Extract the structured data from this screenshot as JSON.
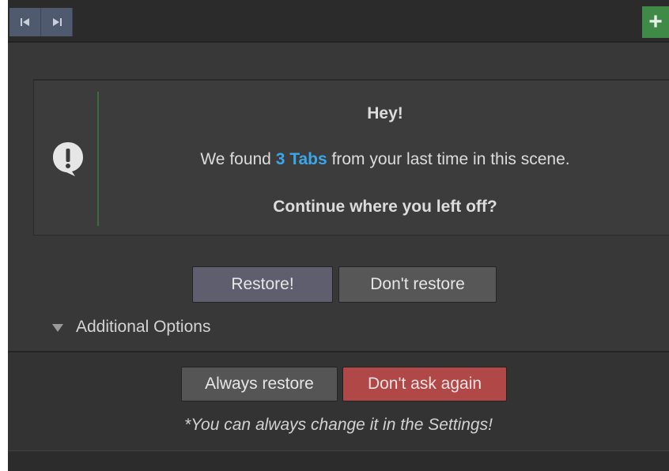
{
  "toolbar": {
    "prev_icon": "skip-back-icon",
    "next_icon": "skip-forward-icon",
    "add_label": "+"
  },
  "notice": {
    "icon": "exclamation-bubble-icon",
    "title": "Hey!",
    "found_prefix": "We found ",
    "found_highlight": "3 Tabs",
    "found_suffix": " from your last time in this scene.",
    "question": "Continue where you left off?"
  },
  "actions": {
    "restore_label": "Restore!",
    "dont_restore_label": "Don't restore"
  },
  "options": {
    "label": "Additional Options",
    "expanded": true,
    "always_restore_label": "Always restore",
    "dont_ask_label": "Don't ask again",
    "hint": "*You can always change it in the Settings!"
  },
  "colors": {
    "highlight": "#3aa7ea",
    "danger_button": "#b04848",
    "add_button": "#3f8a47"
  }
}
